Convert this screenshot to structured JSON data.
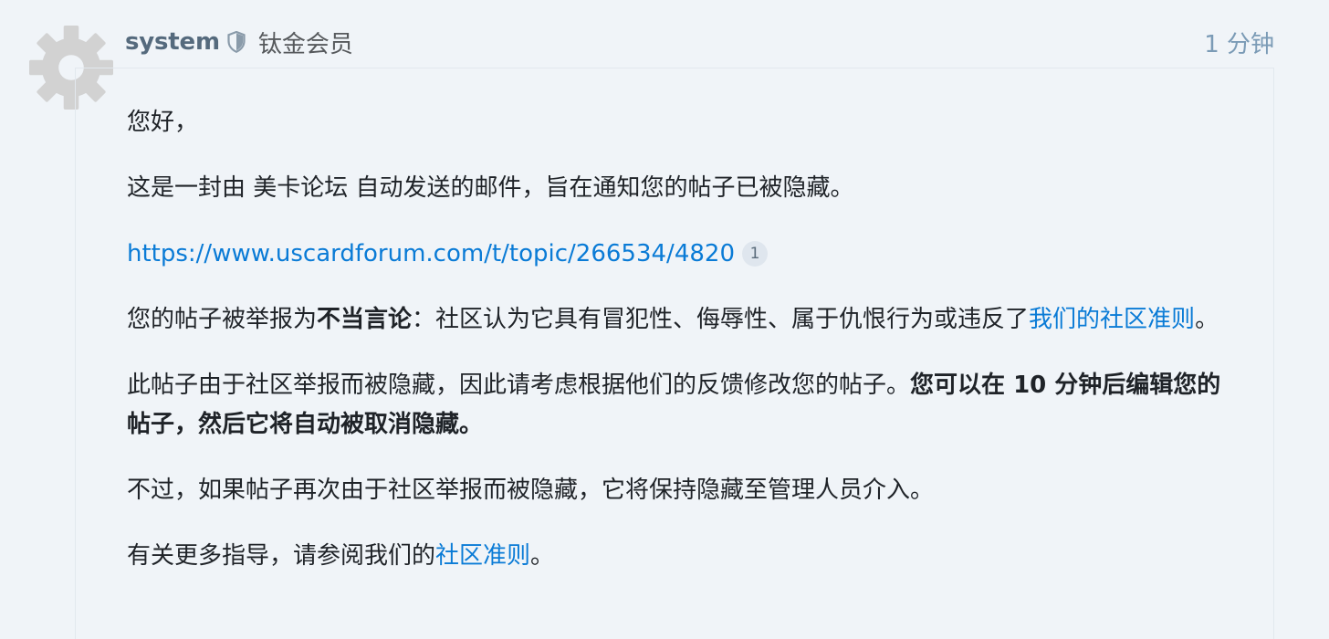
{
  "post": {
    "username": "system",
    "user_title": "钛金会员",
    "date": "1 分钟",
    "icons": {
      "avatar": "gear-icon",
      "moderator": "shield-icon"
    },
    "colors": {
      "username": "#556a7d",
      "date": "#7b9bb6",
      "link": "#0a7bd6",
      "background": "#f0f4f8"
    }
  },
  "body": {
    "greeting": "您好，",
    "intro": "这是一封由 美卡论坛 自动发送的邮件，旨在通知您的帖子已被隐藏。",
    "topic_link": "https://www.uscardforum.com/t/topic/266534/4820",
    "link_clicks": "1",
    "flag_prefix": "您的帖子被举报为",
    "flag_type": "不当言论",
    "flag_desc": "：社区认为它具有冒犯性、侮辱性、属于仇恨行为或违反了",
    "guidelines_link_1": "我们的社区准则",
    "flag_end": "。",
    "hidden_text": "此帖子由于社区举报而被隐藏，因此请考虑根据他们的反馈修改您的帖子。",
    "edit_notice": "您可以在 10 分钟后编辑您的帖子，然后它将自动被取消隐藏。",
    "repeat_notice": "不过，如果帖子再次由于社区举报而被隐藏，它将保持隐藏至管理人员介入。",
    "guidance_prefix": "有关更多指导，请参阅我们的",
    "guidelines_link_2": "社区准则",
    "guidance_end": "。"
  }
}
